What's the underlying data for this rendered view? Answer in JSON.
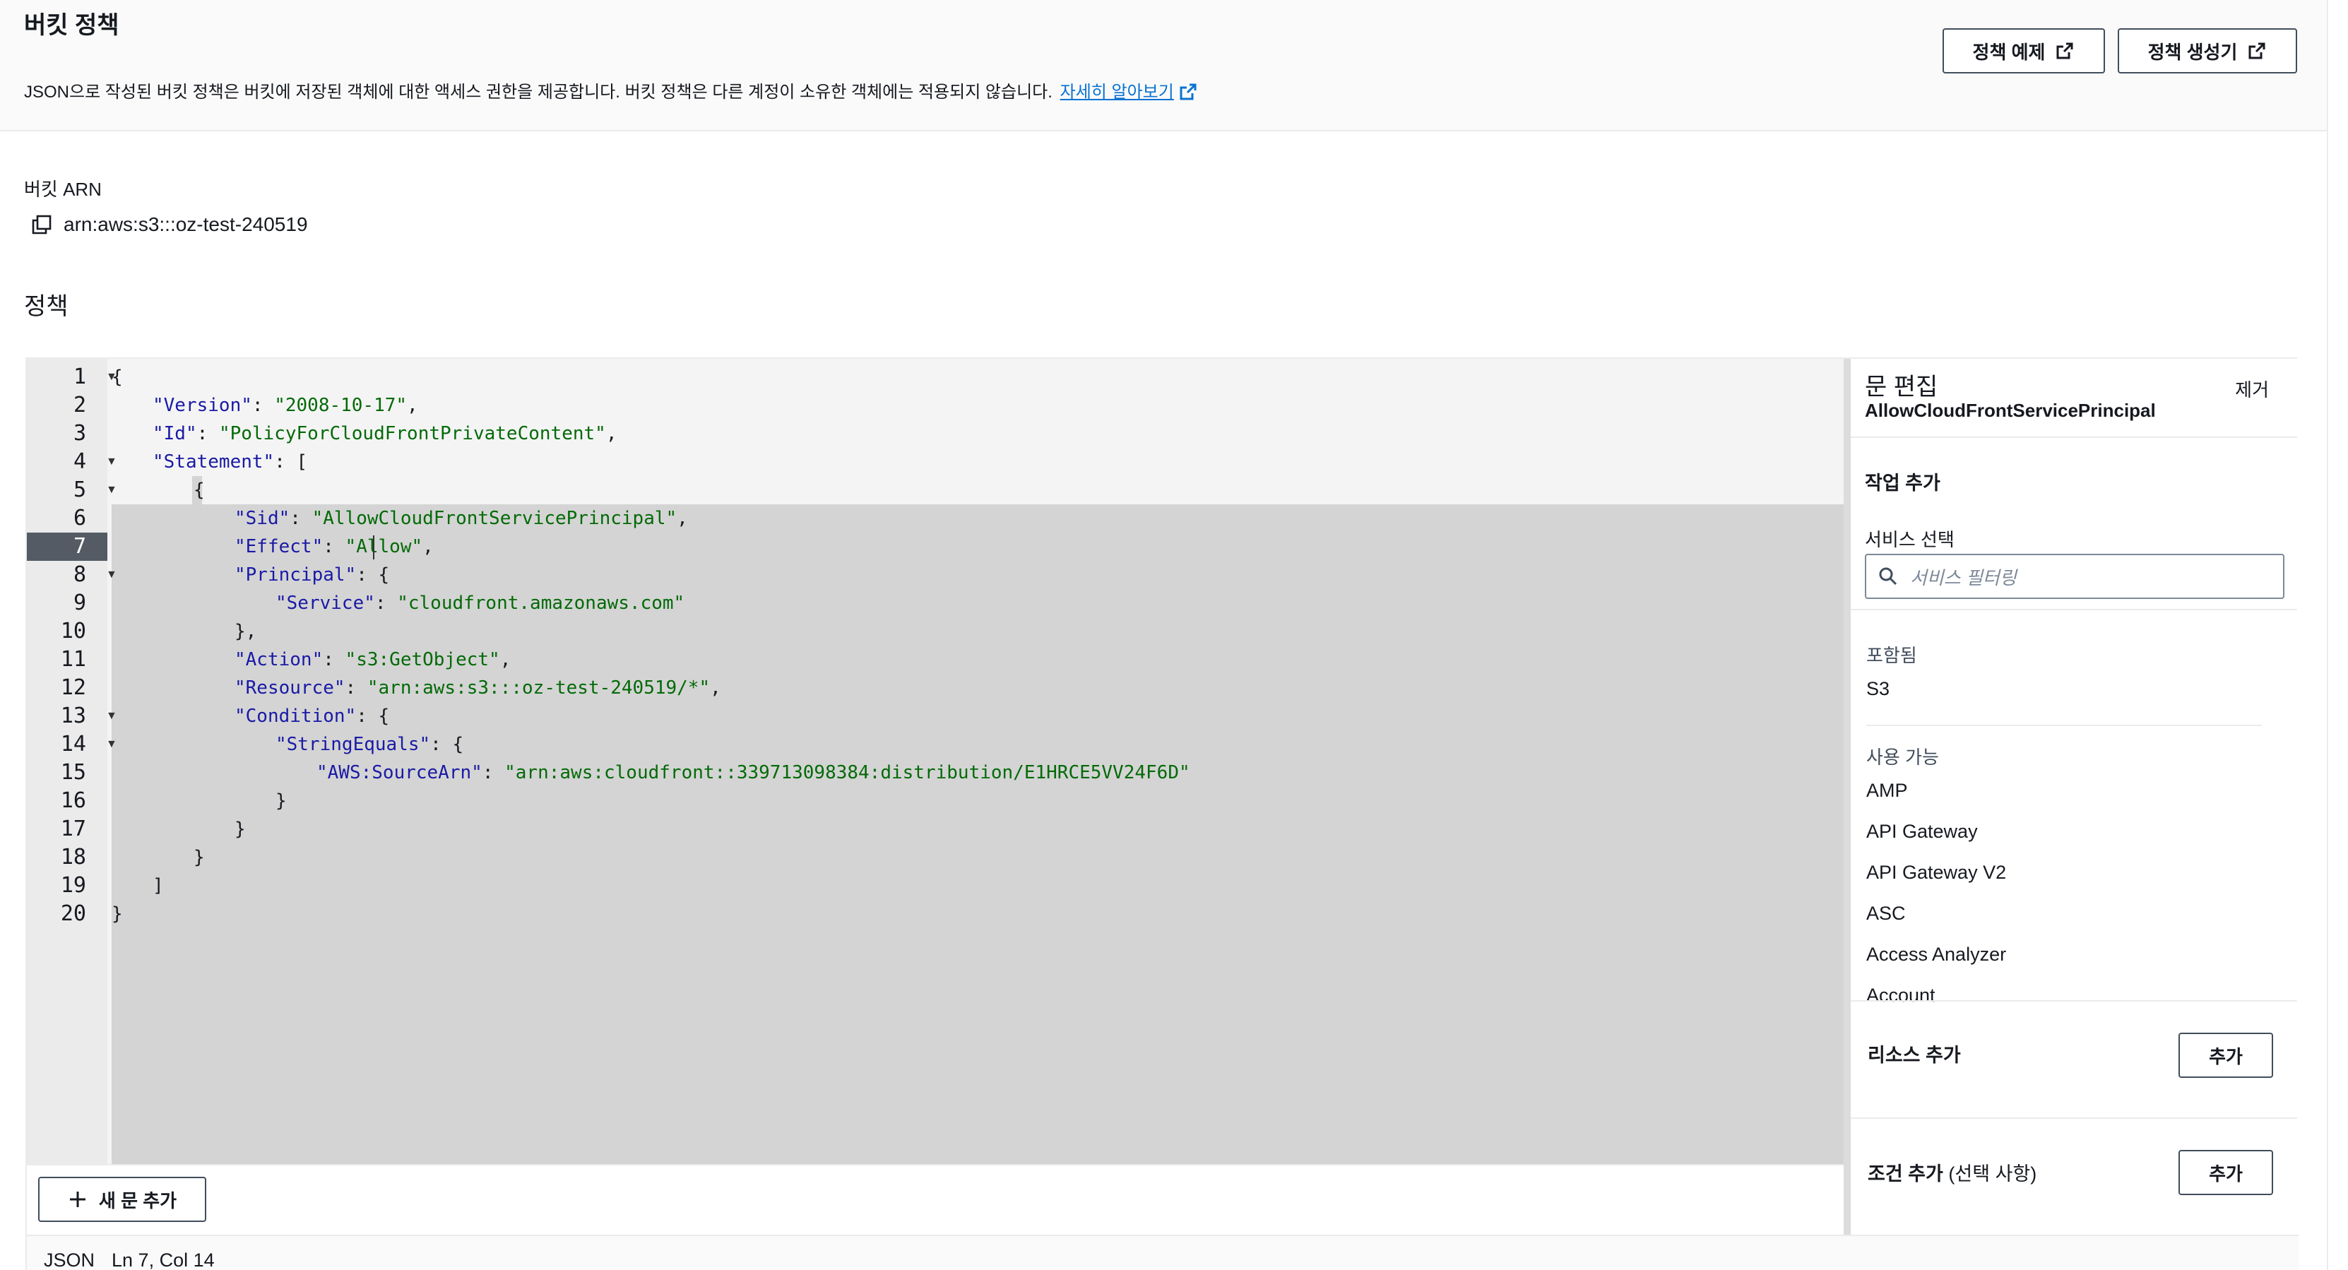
{
  "header": {
    "title": "버킷 정책",
    "description": "JSON으로 작성된 버킷 정책은 버킷에 저장된 객체에 대한 액세스 권한을 제공합니다. 버킷 정책은 다른 계정이 소유한 객체에는 적용되지 않습니다.",
    "learn_more": "자세히 알아보기",
    "btn_examples": "정책 예제",
    "btn_generator": "정책 생성기"
  },
  "arn": {
    "label": "버킷 ARN",
    "value": "arn:aws:s3:::oz-test-240519"
  },
  "policy": {
    "title": "정책"
  },
  "editor": {
    "line_numbers": [
      "1",
      "2",
      "3",
      "4",
      "5",
      "6",
      "7",
      "8",
      "9",
      "10",
      "11",
      "12",
      "13",
      "14",
      "15",
      "16",
      "17",
      "18",
      "19",
      "20"
    ],
    "active_line": "7",
    "code": {
      "l1": "{",
      "l2_key": "\"Version\"",
      "l2_val": "\"2008-10-17\"",
      "l3_key": "\"Id\"",
      "l3_val": "\"PolicyForCloudFrontPrivateContent\"",
      "l4_key": "\"Statement\"",
      "l4_rest": ": [",
      "l5": "{",
      "l6_key": "\"Sid\"",
      "l6_val": "\"AllowCloudFrontServicePrincipal\"",
      "l7_key": "\"Effect\"",
      "l7_val": "\"Allow\"",
      "l8_key": "\"Principal\"",
      "l8_rest": ": {",
      "l9_key": "\"Service\"",
      "l9_val": "\"cloudfront.amazonaws.com\"",
      "l10": "},",
      "l11_key": "\"Action\"",
      "l11_val": "\"s3:GetObject\"",
      "l12_key": "\"Resource\"",
      "l12_val": "\"arn:aws:s3:::oz-test-240519/*\"",
      "l13_key": "\"Condition\"",
      "l13_rest": ": {",
      "l14_key": "\"StringEquals\"",
      "l14_rest": ": {",
      "l15_key": "\"AWS:SourceArn\"",
      "l15_val": "\"arn:aws:cloudfront::339713098384:distribution/E1HRCE5VV24F6D\"",
      "l16": "}",
      "l17": "}",
      "l18": "}",
      "l19": "]",
      "l20": "}"
    },
    "new_statement_btn": "새 문 추가",
    "status_lang": "JSON",
    "status_pos": "Ln 7, Col 14"
  },
  "panel": {
    "title": "문 편집",
    "sid": "AllowCloudFrontServicePrincipal",
    "remove": "제거",
    "add_action": "작업 추가",
    "service_select": "서비스 선택",
    "search_placeholder": "서비스 필터링",
    "included_label": "포함됨",
    "included": [
      "S3"
    ],
    "available_label": "사용 가능",
    "available": [
      "AMP",
      "API Gateway",
      "API Gateway V2",
      "ASC",
      "Access Analyzer",
      "Account"
    ],
    "add_resource": "리소스 추가",
    "add_condition": "조건 추가",
    "add_condition_optional": "(선택 사항)",
    "add_btn": "추가"
  },
  "colors": {
    "link": "#0972d3",
    "json_key": "#1a1aa6",
    "json_string": "#036a07",
    "selection": "#d4d4d4",
    "active_gutter": "#545b64"
  }
}
